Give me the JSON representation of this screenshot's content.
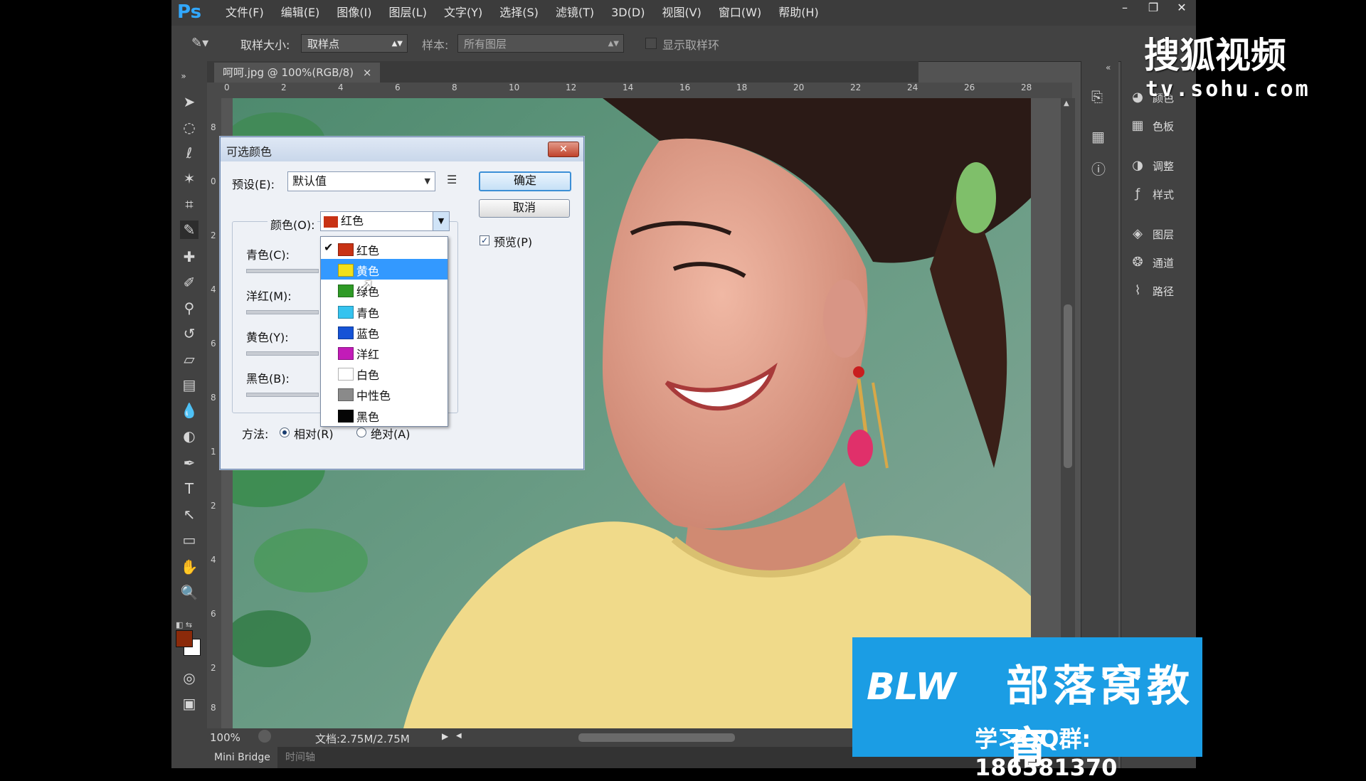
{
  "menubar": {
    "logo": "Ps",
    "items": [
      "文件(F)",
      "编辑(E)",
      "图像(I)",
      "图层(L)",
      "文字(Y)",
      "选择(S)",
      "滤镜(T)",
      "3D(D)",
      "视图(V)",
      "窗口(W)",
      "帮助(H)"
    ],
    "minimize": "–",
    "restore": "❐",
    "close": "✕"
  },
  "options": {
    "sample_size_label": "取样大小:",
    "sample_size_value": "取样点",
    "sample_label": "样本:",
    "sample_value": "所有图层",
    "show_ring_label": "显示取样环"
  },
  "document": {
    "tab_title": "呵呵.jpg @ 100%(RGB/8)",
    "tab_close": "×",
    "ruler_h": [
      "0",
      "2",
      "4",
      "6",
      "8",
      "10",
      "12",
      "14",
      "16",
      "18",
      "20",
      "22",
      "24",
      "26",
      "28"
    ],
    "ruler_v": [
      "8",
      "0",
      "2",
      "4",
      "6",
      "8",
      "1",
      "2",
      "4",
      "6",
      "2",
      "8"
    ]
  },
  "statusbar": {
    "zoom": "100%",
    "doc_info": "文档:2.75M/2.75M"
  },
  "bottom_tabs": [
    "Mini Bridge",
    "时间轴"
  ],
  "panels": [
    {
      "icon": "palette-icon",
      "label": "颜色"
    },
    {
      "icon": "swatches-icon",
      "label": "色板"
    },
    {
      "icon": "adjustments-icon",
      "label": "调整"
    },
    {
      "icon": "styles-icon",
      "label": "样式"
    },
    {
      "icon": "layers-icon",
      "label": "图层"
    },
    {
      "icon": "channels-icon",
      "label": "通道"
    },
    {
      "icon": "paths-icon",
      "label": "路径"
    }
  ],
  "dialog": {
    "title": "可选颜色",
    "close": "✕",
    "preset_label": "预设(E):",
    "preset_value": "默认值",
    "ok": "确定",
    "cancel": "取消",
    "preview_label": "预览(P)",
    "colors_label": "颜色(O):",
    "colors_value": "红色",
    "colors_value_swatch": "#c83214",
    "cyan_label": "青色(C):",
    "magenta_label": "洋红(M):",
    "yellow_label": "黄色(Y):",
    "black_label": "黑色(B):",
    "method_label": "方法:",
    "relative_label": "相对(R)",
    "absolute_label": "绝对(A)"
  },
  "color_dropdown": {
    "items": [
      {
        "label": "红色",
        "swatch": "#c83214",
        "checked": true,
        "selected": false
      },
      {
        "label": "黄色",
        "swatch": "#f2e01c",
        "checked": false,
        "selected": true
      },
      {
        "label": "绿色",
        "swatch": "#2f9a26",
        "checked": false,
        "selected": false
      },
      {
        "label": "青色",
        "swatch": "#35c3ef",
        "checked": false,
        "selected": false
      },
      {
        "label": "蓝色",
        "swatch": "#1553d6",
        "checked": false,
        "selected": false
      },
      {
        "label": "洋红",
        "swatch": "#c21cb8",
        "checked": false,
        "selected": false
      },
      {
        "label": "白色",
        "swatch": "#ffffff",
        "checked": false,
        "selected": false
      },
      {
        "label": "中性色",
        "swatch": "#8a8a8a",
        "checked": false,
        "selected": false
      },
      {
        "label": "黑色",
        "swatch": "#050505",
        "checked": false,
        "selected": false
      }
    ]
  },
  "watermark": {
    "brand": "搜狐视频",
    "url": "tv.sohu.com"
  },
  "ad": {
    "logo": "BLW",
    "name": "部落窝教育",
    "qq": "学习QQ群: 186581370"
  },
  "colors": {
    "accent": "#31a8ff",
    "foreground_color": "#8b2a0a",
    "background_color": "#ffffff"
  }
}
